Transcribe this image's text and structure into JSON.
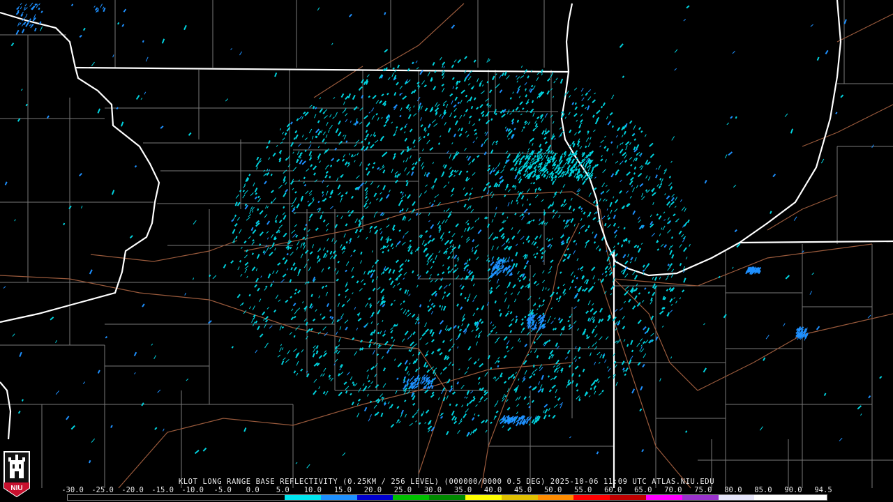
{
  "caption": "KLOT LONG RANGE BASE REFLECTIVITY (0.25KM / 256 LEVEL) (000000/0000 0.5 DEG) 2025-10-06 11:09 UTC  ATLAS.NIU.EDU",
  "logo_text": "NIU",
  "scale": {
    "labels": [
      "-30.0",
      "-25.0",
      "-20.0",
      "-15.0",
      "-10.0",
      "-5.0",
      "0.0",
      "5.0",
      "10.0",
      "15.0",
      "20.0",
      "25.0",
      "30.0",
      "35.0",
      "40.0",
      "45.0",
      "50.0",
      "55.0",
      "60.0",
      "65.0",
      "70.0",
      "75.0",
      "80.0",
      "85.0",
      "90.0",
      "94.5"
    ],
    "colors": [
      "#000000",
      "#000000",
      "#000000",
      "#000000",
      "#000000",
      "#000000",
      "#00e5ee",
      "#1e90ff",
      "#0000d0",
      "#00c000",
      "#008a00",
      "#ffff00",
      "#e0c000",
      "#ff8c00",
      "#ff0000",
      "#c00000",
      "#ff00ff",
      "#9932cc",
      "#e6e6fa",
      "#ffffff",
      "#ffffff"
    ]
  },
  "colors": {
    "state_border": "#ffffff",
    "county_line": "#7a7a7a",
    "highway": "#9a5a3c",
    "echo_primary": "#00d4e0",
    "echo_secondary": "#1e90ff"
  }
}
